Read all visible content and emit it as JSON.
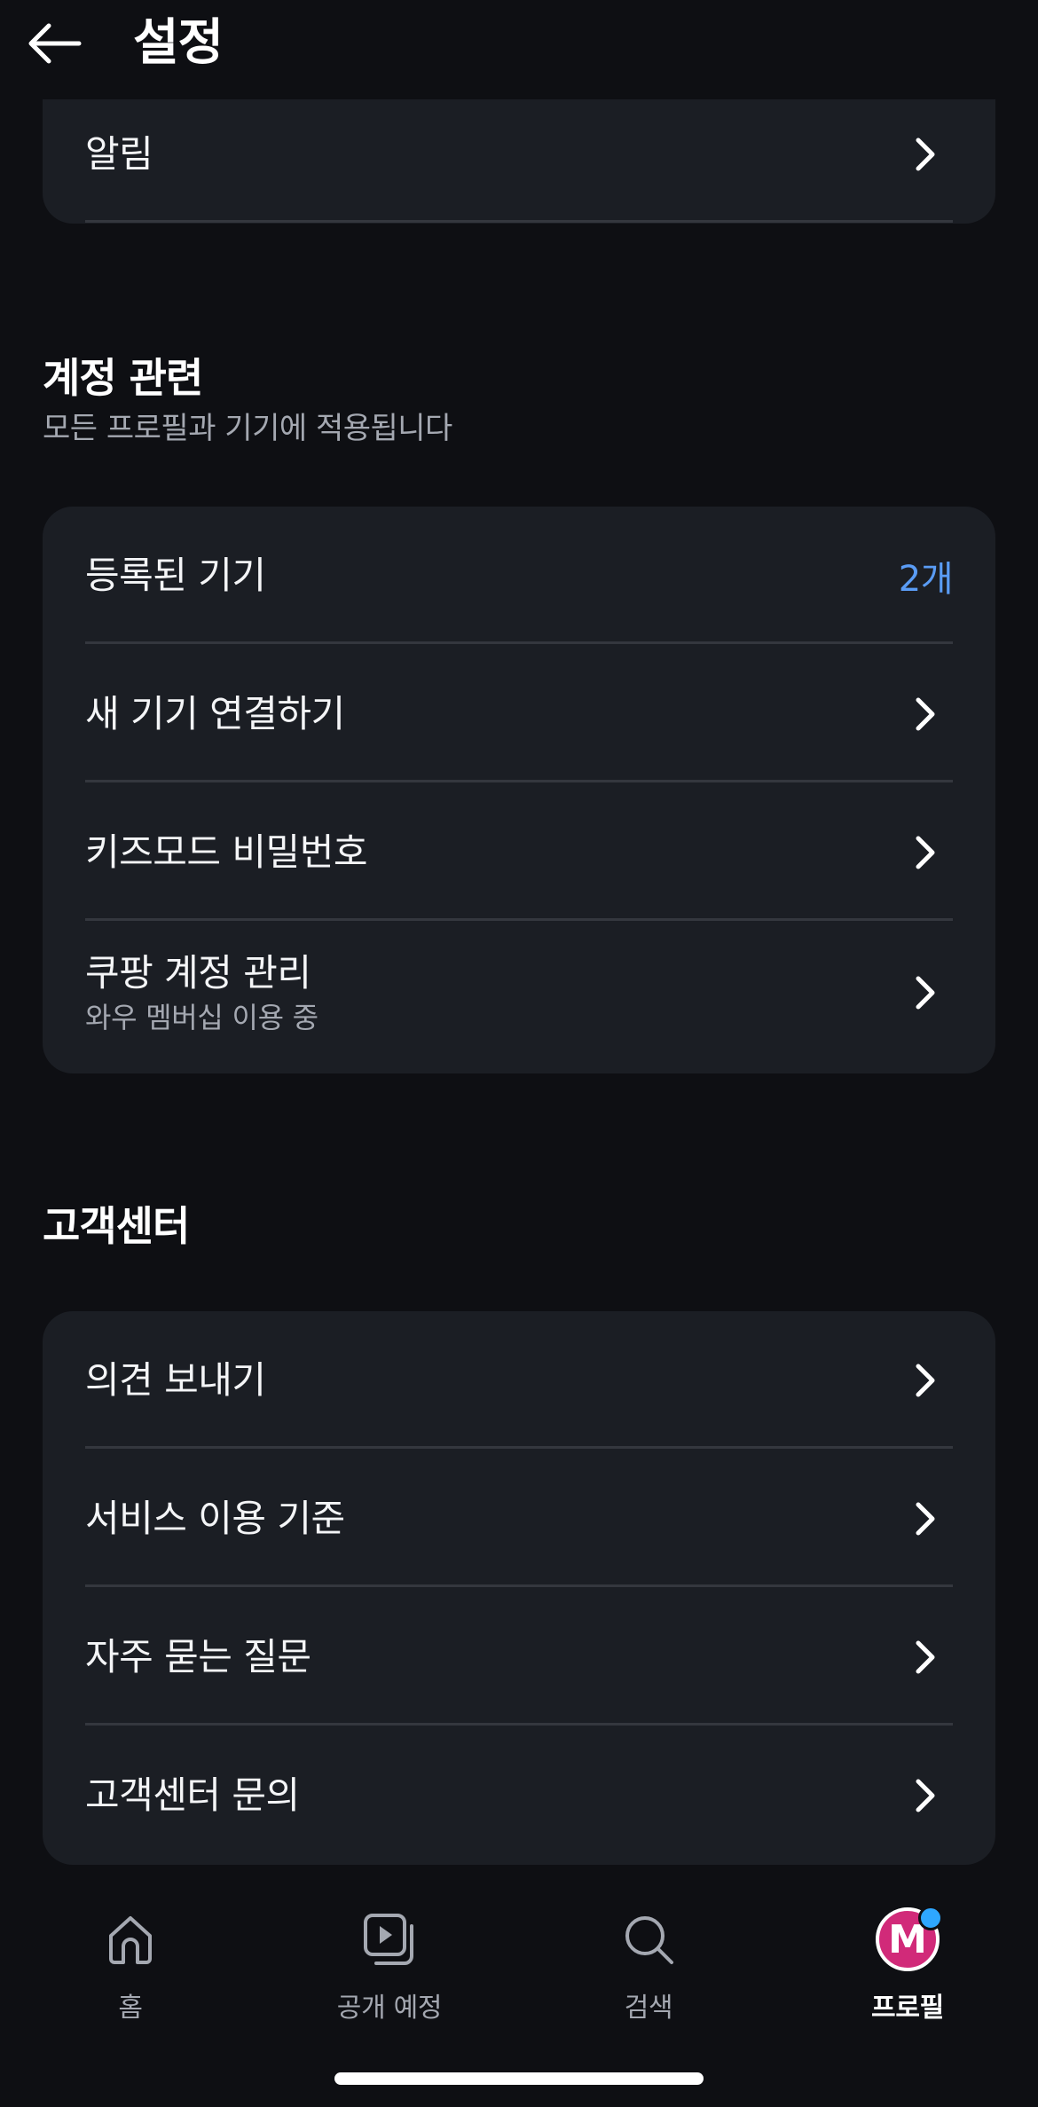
{
  "header": {
    "title": "설정",
    "back_icon": "arrow-left-icon"
  },
  "notifications": {
    "label": "알림"
  },
  "account": {
    "title": "계정 관련",
    "subtitle": "모든 프로필과 기기에 적용됩니다",
    "items": [
      {
        "label": "등록된 기기",
        "value": "2개"
      },
      {
        "label": "새 기기 연결하기"
      },
      {
        "label": "키즈모드 비밀번호"
      },
      {
        "label": "쿠팡 계정 관리",
        "sub": "와우 멤버십 이용 중"
      }
    ]
  },
  "support": {
    "title": "고객센터",
    "items": [
      {
        "label": "의견 보내기"
      },
      {
        "label": "서비스 이용 기준"
      },
      {
        "label": "자주 묻는 질문"
      },
      {
        "label": "고객센터 문의"
      }
    ]
  },
  "bottom_nav": {
    "items": [
      {
        "label": "홈",
        "icon": "home-icon"
      },
      {
        "label": "공개 예정",
        "icon": "upcoming-play-icon"
      },
      {
        "label": "검색",
        "icon": "search-icon"
      },
      {
        "label": "프로필",
        "icon": "profile-avatar",
        "active": true,
        "avatar_letter": "M"
      }
    ]
  },
  "colors": {
    "background": "#0e0f13",
    "card": "#1b1e24",
    "accent_value": "#5a9cf5",
    "avatar": "#d12a79",
    "notification_dot": "#2ea7ff"
  }
}
